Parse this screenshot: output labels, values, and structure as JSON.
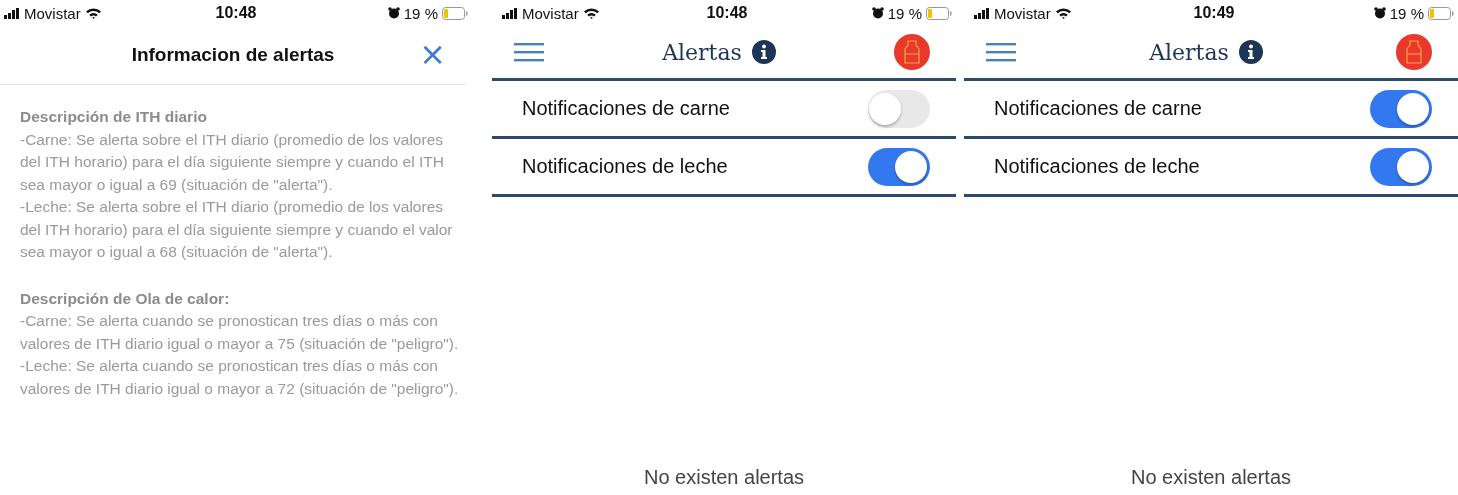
{
  "screens": [
    {
      "kind": "info",
      "status_bar": {
        "carrier": "Movistar",
        "time": "10:48",
        "battery": "19 %"
      },
      "title": "Informacion de alertas",
      "close": "×",
      "sections": [
        {
          "heading": "Descripción de ITH diario",
          "paragraphs": [
            "-Carne: Se alerta sobre el ITH diario (promedio de los valores del ITH horario) para el día siguiente siempre y cuando el ITH sea mayor o igual a 69 (situación de \"alerta\").",
            "-Leche: Se alerta sobre el ITH diario (promedio de los valores del ITH horario) para el día siguiente siempre y cuando el valor sea mayor o igual a 68 (situación de \"alerta\")."
          ]
        },
        {
          "heading": "Descripción de Ola de calor:",
          "paragraphs": [
            "-Carne: Se alerta cuando se pronostican tres días o más con valores de ITH diario igual o mayor a 75 (situación de \"peligro\").",
            "-Leche: Se alerta cuando se pronostican tres días o más con valores de ITH diario igual o mayor a 72 (situación de \"peligro\")."
          ]
        }
      ]
    },
    {
      "kind": "settings",
      "status_bar": {
        "carrier": "Movistar",
        "time": "10:48",
        "battery": "19 %"
      },
      "title": "Alertas",
      "toggles": [
        {
          "label": "Notificaciones de carne",
          "on": false
        },
        {
          "label": "Notificaciones de leche",
          "on": true
        }
      ],
      "empty_message": "No existen alertas"
    },
    {
      "kind": "settings",
      "status_bar": {
        "carrier": "Movistar",
        "time": "10:49",
        "battery": "19 %"
      },
      "title": "Alertas",
      "toggles": [
        {
          "label": "Notificaciones de carne",
          "on": true
        },
        {
          "label": "Notificaciones de leche",
          "on": true
        }
      ],
      "empty_message": "No existen alertas"
    }
  ]
}
